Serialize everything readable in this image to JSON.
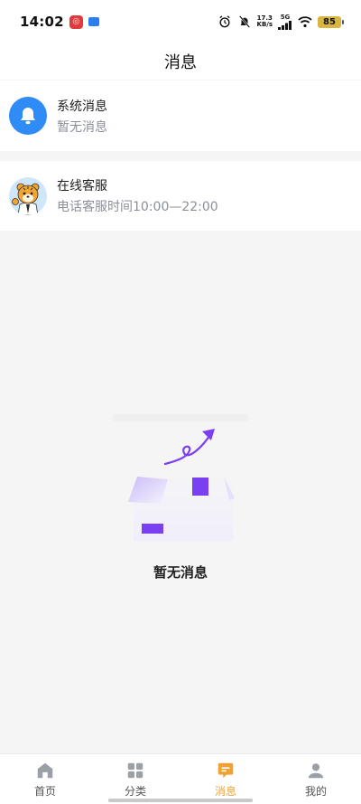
{
  "status_bar": {
    "time": "14:02",
    "net_speed_value": "17.3",
    "net_speed_unit": "KB/s",
    "signal_label": "5G",
    "battery": "85"
  },
  "header": {
    "title": "消息"
  },
  "messages": [
    {
      "title": "系统消息",
      "subtitle": "暂无消息",
      "icon": "bell-icon"
    },
    {
      "title": "在线客服",
      "subtitle": "电话客服时间10:00—22:00",
      "icon": "tiger-mascot-avatar"
    }
  ],
  "empty_state": {
    "text": "暂无消息"
  },
  "tabs": [
    {
      "label": "首页",
      "icon": "home-icon",
      "active": false
    },
    {
      "label": "分类",
      "icon": "grid-icon",
      "active": false
    },
    {
      "label": "消息",
      "icon": "message-icon",
      "active": true
    },
    {
      "label": "我的",
      "icon": "person-icon",
      "active": false
    }
  ],
  "colors": {
    "accent": "#f0a334",
    "bell_blue": "#2f8bf5",
    "background": "#f5f5f5",
    "purple": "#7a3ff0"
  }
}
